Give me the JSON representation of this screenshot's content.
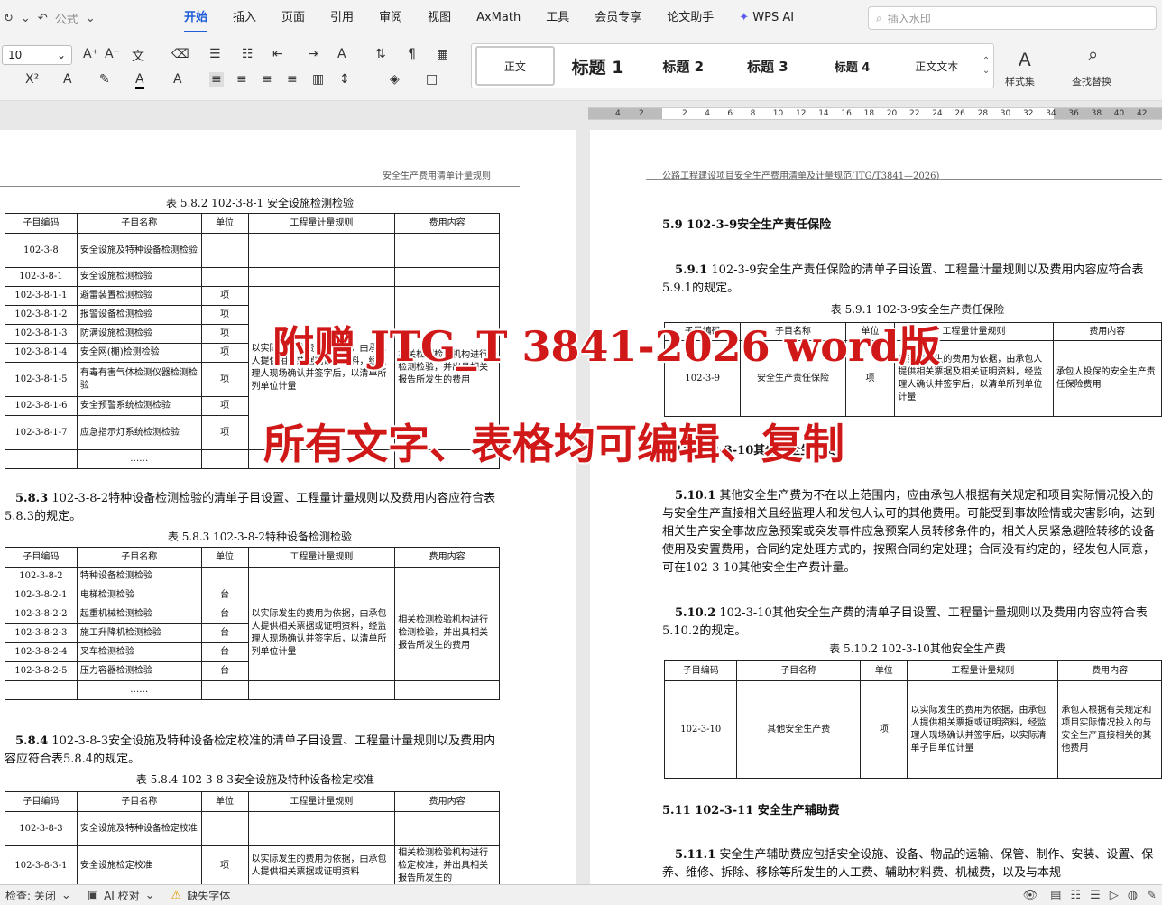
{
  "menu": {
    "quick": [
      "公式"
    ],
    "tabs": [
      "开始",
      "插入",
      "页面",
      "引用",
      "审阅",
      "视图",
      "AxMath",
      "工具",
      "会员专享",
      "论文助手",
      "WPS AI"
    ],
    "search_placeholder": "插入水印"
  },
  "ribbon": {
    "font_size": "10",
    "styles": [
      "正文",
      "标题 1",
      "标题 2",
      "标题 3",
      "标题 4",
      "正文文本"
    ],
    "style_set": "样式集",
    "find_replace": "查找替换"
  },
  "ruler": {
    "nums": [
      "4",
      "2",
      "2",
      "4",
      "6",
      "8",
      "10",
      "12",
      "14",
      "16",
      "18",
      "20",
      "22",
      "24",
      "26",
      "28",
      "30",
      "32",
      "34",
      "36",
      "38",
      "40",
      "42"
    ]
  },
  "left": {
    "header": "安全生产费用清单计量规则",
    "cap1": "表 5.8.2  102-3-8-1 安全设施检测检验",
    "cols": [
      "子目编码",
      "子目名称",
      "单位",
      "工程量计量规则",
      "费用内容"
    ],
    "t1": [
      [
        "102-3-8",
        "安全设施及特种设备检测检验",
        ""
      ],
      [
        "102-3-8-1",
        "安全设施检测检验",
        ""
      ],
      [
        "102-3-8-1-1",
        "避雷装置检测检验",
        "项"
      ],
      [
        "102-3-8-1-2",
        "报警设备检测检验",
        "项"
      ],
      [
        "102-3-8-1-3",
        "防满设施检测检验",
        "项"
      ],
      [
        "102-3-8-1-4",
        "安全网(棚)检测检验",
        "项"
      ],
      [
        "102-3-8-1-5",
        "有毒有害气体检测仪器检测检验",
        "项"
      ],
      [
        "102-3-8-1-6",
        "安全预警系统检测检验",
        "项"
      ],
      [
        "102-3-8-1-7",
        "应急指示灯系统检测检验",
        "项"
      ],
      [
        "",
        "……",
        ""
      ]
    ],
    "t1_rule": "以实际发生的费用为依据，由承包人提供相关票据或证明资料，经监理人现场确认并签字后，以清单所列单位计量",
    "t1_fee": "相关检测检验机构进行检测检验，并出具相关报告所发生的费用",
    "p1_num": "5.8.3",
    "p1": "102-3-8-2特种设备检测检验的清单子目设置、工程量计量规则以及费用内容应符合表5.8.3的规定。",
    "cap2": "表 5.8.3  102-3-8-2特种设备检测检验",
    "t2": [
      [
        "102-3-8-2",
        "特种设备检测检验",
        ""
      ],
      [
        "102-3-8-2-1",
        "电梯检测检验",
        "台"
      ],
      [
        "102-3-8-2-2",
        "起重机械检测检验",
        "台"
      ],
      [
        "102-3-8-2-3",
        "施工升降机检测检验",
        "台"
      ],
      [
        "102-3-8-2-4",
        "叉车检测检验",
        "台"
      ],
      [
        "102-3-8-2-5",
        "压力容器检测检验",
        "台"
      ],
      [
        "",
        "……",
        ""
      ]
    ],
    "t2_rule": "以实际发生的费用为依据，由承包人提供相关票据或证明资料，经监理人现场确认并签字后，以清单所列单位计量",
    "t2_fee": "相关检测检验机构进行检测检验，并出具相关报告所发生的费用",
    "p2_num": "5.8.4",
    "p2": "102-3-8-3安全设施及特种设备检定校准的清单子目设置、工程量计量规则以及费用内容应符合表5.8.4的规定。",
    "cap3": "表 5.8.4 102-3-8-3安全设施及特种设备检定校准",
    "t3": [
      [
        "102-3-8-3",
        "安全设施及特种设备检定校准",
        ""
      ],
      [
        "102-3-8-3-1",
        "安全设施检定校准",
        "项"
      ]
    ],
    "t3_rule": "以实际发生的费用为依据，由承包人提供相关票据或证明资料",
    "t3_fee": "相关检测检验机构进行检定校准，并出具相关报告所发生的"
  },
  "right": {
    "header": "公路工程建设项目安全生产费用清单及计量规范(JTG/T3841—2026)",
    "h59": "5.9  102-3-9安全生产责任保险",
    "p591_num": "5.9.1",
    "p591": "102-3-9安全生产责任保险的清单子目设置、工程量计量规则以及费用内容应符合表5.9.1的规定。",
    "cap591": "表 5.9.1  102-3-9安全生产责任保险",
    "cols": [
      "子目编码",
      "子目名称",
      "单位",
      "工程量计量规则",
      "费用内容"
    ],
    "t591": [
      "102-3-9",
      "安全生产责任保险",
      "项",
      "以实际发生的费用为依据，由承包人提供相关票据及相关证明资料，经监理人确认并签字后，以清单所列单位计量",
      "承包人投保的安全生产责任保险费用"
    ],
    "h510": "5.10  102-3-10其他安全生产费",
    "p5101_num": "5.10.1",
    "p5101": "其他安全生产费为不在以上范围内，应由承包人根据有关规定和项目实际情况投入的与安全生产直接相关且经监理人和发包人认可的其他费用。可能受到事故险情或灾害影响，达到相关生产安全事故应急预案或突发事件应急预案人员转移条件的，相关人员紧急避险转移的设备使用及安置费用，合同约定处理方式的，按照合同约定处理；合同没有约定的，经发包人同意，可在102-3-10其他安全生产费计量。",
    "p5102_num": "5.10.2",
    "p5102": "102-3-10其他安全生产费的清单子目设置、工程量计量规则以及费用内容应符合表5.10.2的规定。",
    "cap5102": "表 5.10.2  102-3-10其他安全生产费",
    "t5102": [
      "102-3-10",
      "其他安全生产费",
      "项",
      "以实际发生的费用为依据，由承包人提供相关票据或证明资料，经监理人现场确认并签字后，以实际清单子目单位计量",
      "承包人根据有关规定和项目实际情况投入的与安全生产直接相关的其他费用"
    ],
    "h511": "5.11  102-3-11  安全生产辅助费",
    "p5111_num": "5.11.1",
    "p5111": "安全生产辅助费应包括安全设施、设备、物品的运输、保管、制作、安装、设置、保养、维修、拆除、移除等所发生的人工费、辅助材料费、机械费，以及与本规"
  },
  "overlay": {
    "line1": "附赠 JTG_T 3841-2026 word版",
    "line2": "所有文字、表格均可编辑、复制"
  },
  "status": {
    "spell": "检查: 关闭",
    "ai": "AI 校对",
    "font": "缺失字体"
  }
}
